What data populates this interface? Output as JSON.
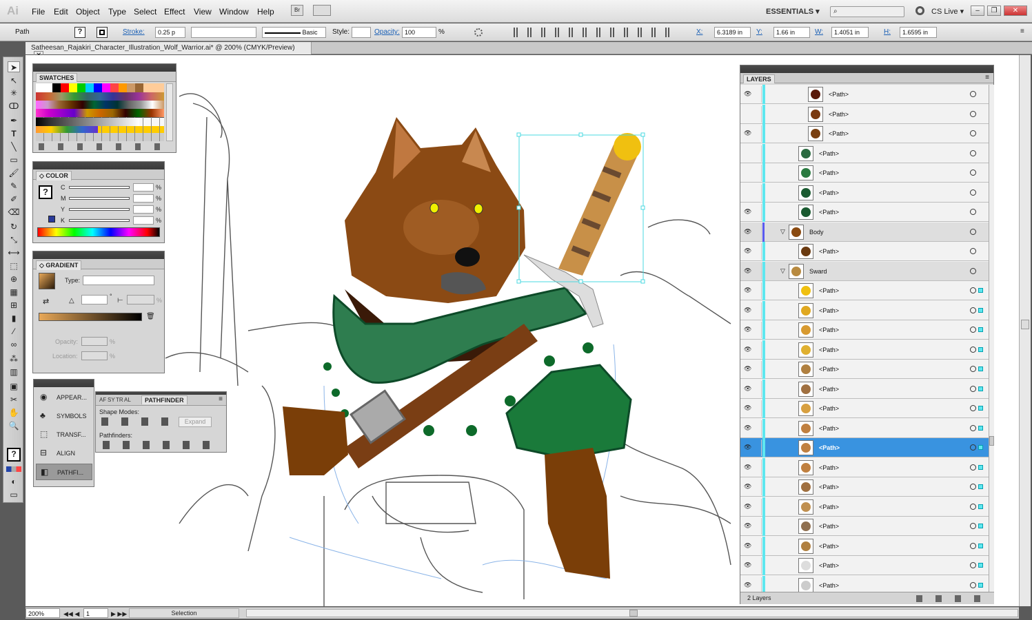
{
  "app": {
    "logo": "Ai"
  },
  "menubar": {
    "items": [
      "File",
      "Edit",
      "Object",
      "Type",
      "Select",
      "Effect",
      "View",
      "Window",
      "Help"
    ],
    "bridge": "Br",
    "workspace": "ESSENTIALS",
    "cslive": "CS Live"
  },
  "control": {
    "selection_type": "Path",
    "stroke_label": "Stroke:",
    "stroke_value": "0.25 p",
    "brush": "Basic",
    "style_label": "Style:",
    "opacity_label": "Opacity:",
    "opacity_value": "100",
    "opacity_unit": "%",
    "x_label": "X:",
    "x_value": "6.3189 in",
    "y_label": "Y:",
    "y_value": "1.66 in",
    "w_label": "W:",
    "w_value": "1.4051 in",
    "h_label": "H:",
    "h_value": "1.6595 in"
  },
  "document": {
    "tab_title": "Satheesan_Rajakiri_Character_Illustration_Wolf_Warrior.ai* @ 200% (CMYK/Preview)"
  },
  "swatches": {
    "title": "SWATCHES"
  },
  "color": {
    "title": "COLOR",
    "channels": [
      "C",
      "M",
      "Y",
      "K"
    ],
    "unit": "%"
  },
  "gradient": {
    "title": "GRADIENT",
    "type_label": "Type:",
    "opacity_label": "Opacity:",
    "location_label": "Location:",
    "unit": "%",
    "angle_unit": "°"
  },
  "dock": {
    "items": [
      "APPEAR...",
      "SYMBOLS",
      "TRANSF...",
      "ALIGN",
      "PATHFI..."
    ]
  },
  "pathfinder": {
    "tabs": [
      "AF",
      "SY",
      "TR",
      "AL"
    ],
    "title": "PATHFINDER",
    "shape_modes": "Shape Modes:",
    "expand": "Expand",
    "pathfinders": "Pathfinders:"
  },
  "layers": {
    "title": "LAYERS",
    "footer": "2 Layers",
    "rows": [
      {
        "name": "<Path>",
        "indent": 2,
        "thumb": "#5a1a0a",
        "state": "eye"
      },
      {
        "name": "<Path>",
        "indent": 2,
        "thumb": "#7a3a10",
        "state": "none"
      },
      {
        "name": "<Path>",
        "indent": 2,
        "thumb": "#7a4010",
        "state": "eye"
      },
      {
        "name": "<Path>",
        "indent": 1,
        "thumb": "#2a6a40",
        "state": "none"
      },
      {
        "name": "<Path>",
        "indent": 1,
        "thumb": "#2a7a40",
        "state": "none"
      },
      {
        "name": "<Path>",
        "indent": 1,
        "thumb": "#1a5a30",
        "state": "none"
      },
      {
        "name": "<Path>",
        "indent": 1,
        "thumb": "#1a5a30",
        "state": "eye"
      },
      {
        "name": "Body",
        "indent": 0,
        "thumb": "#8a4a10",
        "state": "eye",
        "group": true
      },
      {
        "name": "<Path>",
        "indent": 1,
        "thumb": "#6a3a10",
        "state": "eye"
      },
      {
        "name": "Sward",
        "indent": 0,
        "thumb": "#b88a40",
        "state": "eye",
        "group": true
      },
      {
        "name": "<Path>",
        "indent": 1,
        "thumb": "#f0c010",
        "state": "eye"
      },
      {
        "name": "<Path>",
        "indent": 1,
        "thumb": "#e0a820",
        "state": "eye"
      },
      {
        "name": "<Path>",
        "indent": 1,
        "thumb": "#d89a30",
        "state": "eye"
      },
      {
        "name": "<Path>",
        "indent": 1,
        "thumb": "#e0b030",
        "state": "eye"
      },
      {
        "name": "<Path>",
        "indent": 1,
        "thumb": "#b08040",
        "state": "eye"
      },
      {
        "name": "<Path>",
        "indent": 1,
        "thumb": "#a07040",
        "state": "eye"
      },
      {
        "name": "<Path>",
        "indent": 1,
        "thumb": "#d8a040",
        "state": "eye"
      },
      {
        "name": "<Path>",
        "indent": 1,
        "thumb": "#c08040",
        "state": "eye"
      },
      {
        "name": "<Path>",
        "indent": 1,
        "thumb": "#c08040",
        "state": "eye",
        "selected": true
      },
      {
        "name": "<Path>",
        "indent": 1,
        "thumb": "#c08040",
        "state": "eye"
      },
      {
        "name": "<Path>",
        "indent": 1,
        "thumb": "#a07040",
        "state": "eye"
      },
      {
        "name": "<Path>",
        "indent": 1,
        "thumb": "#c09050",
        "state": "eye"
      },
      {
        "name": "<Path>",
        "indent": 1,
        "thumb": "#907050",
        "state": "eye"
      },
      {
        "name": "<Path>",
        "indent": 1,
        "thumb": "#b08040",
        "state": "eye"
      },
      {
        "name": "<Path>",
        "indent": 1,
        "thumb": "#dddddd",
        "state": "eye"
      },
      {
        "name": "<Path>",
        "indent": 1,
        "thumb": "#cccccc",
        "state": "eye"
      }
    ]
  },
  "status": {
    "zoom": "200%",
    "artboard": "1",
    "tool": "Selection"
  },
  "colors": {
    "selection": "#3993e0",
    "cyan": "#5ee7ef",
    "wolf": "#8b4a14",
    "cape": "#2e7d4f"
  }
}
